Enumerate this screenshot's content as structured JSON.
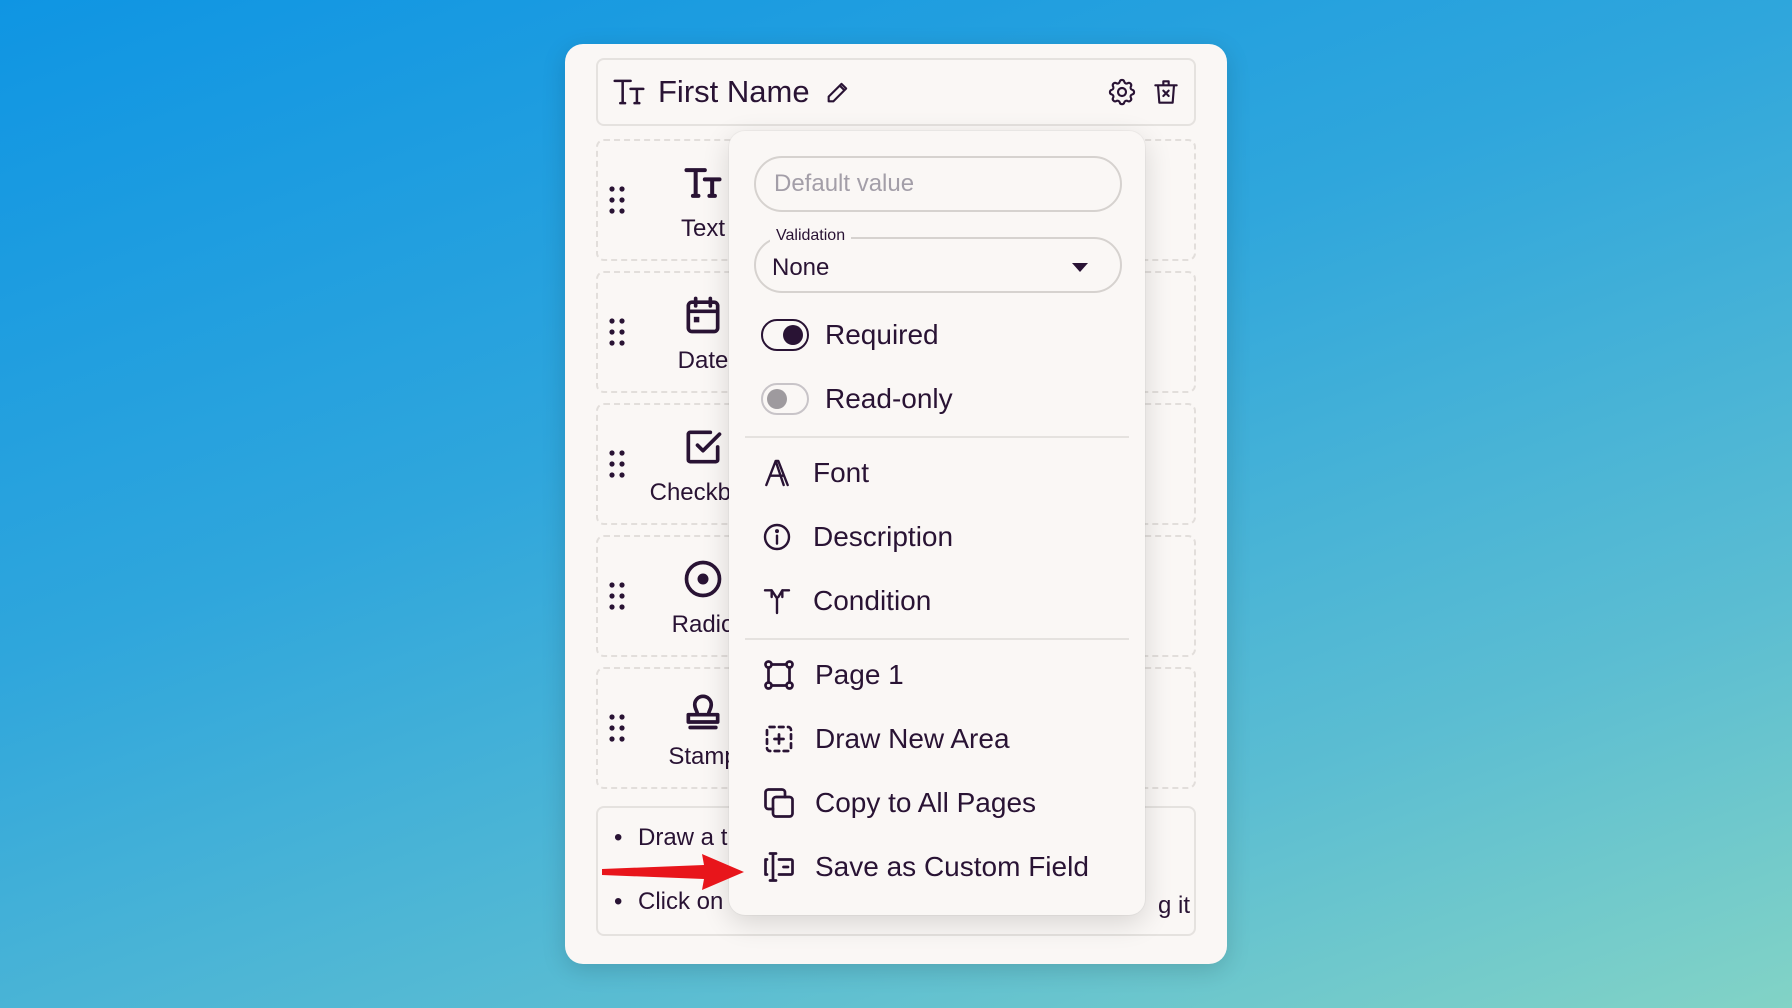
{
  "header": {
    "title": "First Name"
  },
  "field_types": [
    {
      "label": "Text",
      "icon": "text-size-icon"
    },
    {
      "label": "Date",
      "icon": "calendar-icon"
    },
    {
      "label": "Checkbox",
      "icon": "checkbox-icon"
    },
    {
      "label": "Radio",
      "icon": "radio-icon"
    },
    {
      "label": "Stamp",
      "icon": "stamp-icon"
    }
  ],
  "info": {
    "line1": "Draw a t",
    "line3": "Click on",
    "line3_trail": "g it"
  },
  "menu": {
    "default_value_placeholder": "Default value",
    "validation": {
      "label": "Validation",
      "value": "None"
    },
    "required": {
      "label": "Required",
      "on": true
    },
    "readonly": {
      "label": "Read-only",
      "on": false
    },
    "font": "Font",
    "description": "Description",
    "condition": "Condition",
    "page": "Page 1",
    "draw_area": "Draw New Area",
    "copy_all": "Copy to All Pages",
    "save_custom": "Save as Custom Field"
  },
  "colors": {
    "text": "#291334",
    "card": "#faf7f5",
    "arrow": "#e8151b"
  }
}
